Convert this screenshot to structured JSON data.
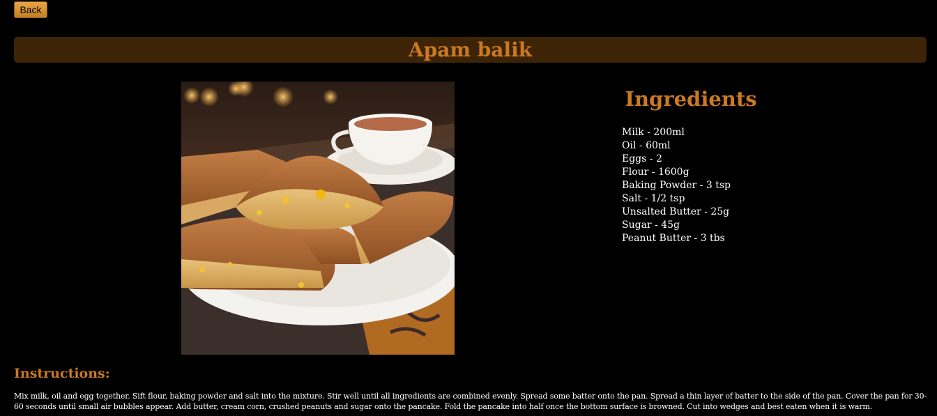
{
  "nav": {
    "back_label": "Back"
  },
  "recipe": {
    "title": "Apam balik",
    "image_alt": "Apam balik pancake wedges on a white plate with a cup of tea"
  },
  "ingredients": {
    "heading": "Ingredients",
    "items": [
      "Milk - 200ml",
      "Oil - 60ml",
      "Eggs - 2",
      "Flour - 1600g",
      "Baking Powder - 3 tsp",
      "Salt - 1/2 tsp",
      "Unsalted Butter - 25g",
      "Sugar - 45g",
      "Peanut Butter - 3 tbs"
    ]
  },
  "instructions": {
    "heading": "Instructions:",
    "text": "Mix milk, oil and egg together. Sift flour, baking powder and salt into the mixture. Stir well until all ingredients are combined evenly. Spread some batter onto the pan. Spread a thin layer of batter to the side of the pan. Cover the pan for 30-60 seconds until small air bubbles appear. Add butter, cream corn, crushed peanuts and sugar onto the pancake. Fold the pancake into half once the bottom surface is browned. Cut into wedges and best eaten when it is warm."
  },
  "colors": {
    "background": "#000000",
    "accent": "#c97a22",
    "title_bar": "#3d2406",
    "button": "#d9922f"
  }
}
